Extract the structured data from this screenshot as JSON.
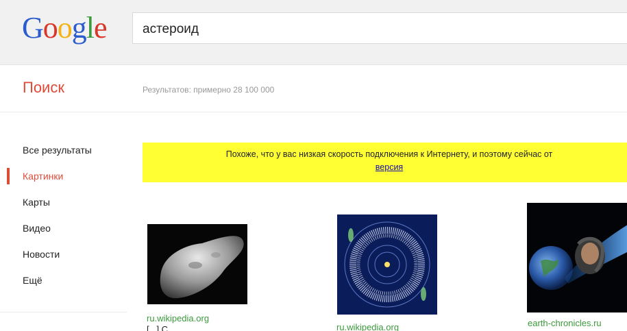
{
  "logo": {
    "letters": [
      "G",
      "o",
      "o",
      "g",
      "l",
      "e"
    ]
  },
  "search": {
    "query": "астероид"
  },
  "header": {
    "section_title": "Поиск",
    "results_count": "Результатов: примерно 28 100 000"
  },
  "sidebar": {
    "items": [
      {
        "label": "Все результаты",
        "active": false
      },
      {
        "label": "Картинки",
        "active": true
      },
      {
        "label": "Карты",
        "active": false
      },
      {
        "label": "Видео",
        "active": false
      },
      {
        "label": "Новости",
        "active": false
      },
      {
        "label": "Ещё",
        "active": false
      }
    ]
  },
  "notice": {
    "text": "Похоже, что у вас низкая скорость подключения к Интернету, и поэтому сейчас от",
    "link_text": "версия"
  },
  "results": [
    {
      "domain": "ru.wikipedia.org",
      "caption": "[...] С...",
      "thumb": "asteroid-photo"
    },
    {
      "domain": "ru.wikipedia.org",
      "caption": "",
      "thumb": "asteroid-belt-diagram"
    },
    {
      "domain": "earth-chronicles.ru",
      "caption": "",
      "thumb": "earth-and-asteroid-art"
    }
  ],
  "colors": {
    "accent_red": "#dd4b39",
    "link_green": "#3b9a3b",
    "notice_yellow": "#ffff33",
    "link_blue": "#1a0dab"
  }
}
